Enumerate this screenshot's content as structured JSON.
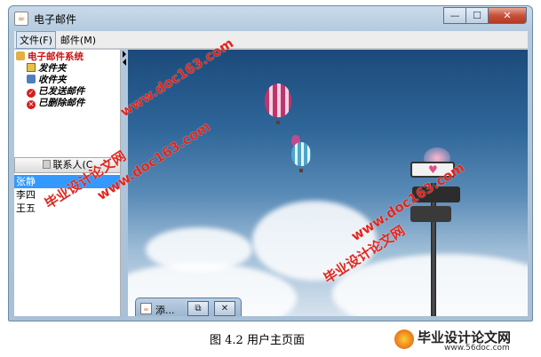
{
  "window": {
    "title": "电子邮件",
    "controls": [
      "—",
      "☐",
      "✕"
    ]
  },
  "menubar": [
    {
      "label": "文件(F)"
    },
    {
      "label": "邮件(M)"
    }
  ],
  "tree": {
    "root": "电子邮件系统",
    "items": [
      "发件夹",
      "收件夹",
      "已发送邮件",
      "已删除邮件"
    ]
  },
  "contacts": {
    "header": "联系人(C",
    "items": [
      "张静",
      "李四",
      "王五"
    ],
    "selected": "张静"
  },
  "internal_frame": {
    "title": "添...",
    "restore": "⧉",
    "close": "✕"
  },
  "watermarks": [
    "www.doc163.com",
    "毕业设计论文网",
    "www.doc163.com",
    "毕业设计论文网",
    "www.doc163.com"
  ],
  "caption": "图 4.2   用户主页面",
  "logo": {
    "text": "毕业设计论文网",
    "url": "www.56doc.com"
  },
  "colors": {
    "selection": "#3399ff",
    "watermark": "#e0261d",
    "tree_root": "#cc1010"
  }
}
